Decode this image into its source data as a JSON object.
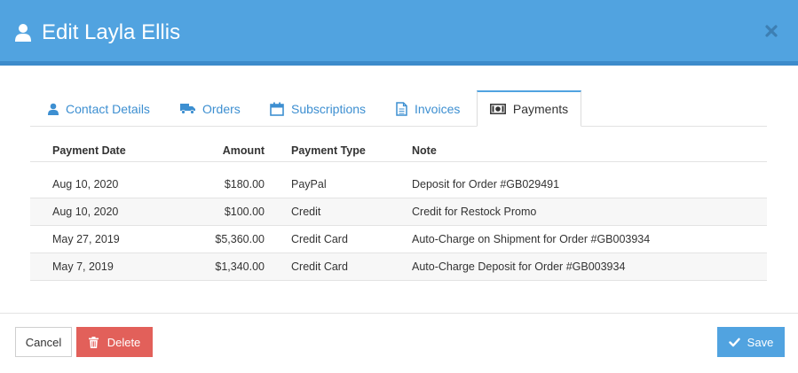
{
  "header": {
    "title": "Edit Layla Ellis"
  },
  "tabs": [
    {
      "label": "Contact Details",
      "icon": "user-icon"
    },
    {
      "label": "Orders",
      "icon": "truck-icon"
    },
    {
      "label": "Subscriptions",
      "icon": "calendar-icon"
    },
    {
      "label": "Invoices",
      "icon": "document-icon"
    },
    {
      "label": "Payments",
      "icon": "money-icon",
      "active": true
    }
  ],
  "table": {
    "columns": [
      "Payment Date",
      "Amount",
      "Payment Type",
      "Note"
    ],
    "rows": [
      [
        "Aug 10, 2020",
        "$180.00",
        "PayPal",
        "Deposit for Order #GB029491"
      ],
      [
        "Aug 10, 2020",
        "$100.00",
        "Credit",
        "Credit for Restock Promo"
      ],
      [
        "May 27, 2019",
        "$5,360.00",
        "Credit Card",
        "Auto-Charge on Shipment for Order #GB003934"
      ],
      [
        "May 7, 2019",
        "$1,340.00",
        "Credit Card",
        "Auto-Charge Deposit for Order #GB003934"
      ]
    ]
  },
  "footer": {
    "cancel_label": "Cancel",
    "delete_label": "Delete",
    "save_label": "Save"
  },
  "colors": {
    "header": "#51a3e0",
    "link": "#3d8fd1",
    "delete": "#e2605a",
    "save": "#51a3e0"
  }
}
